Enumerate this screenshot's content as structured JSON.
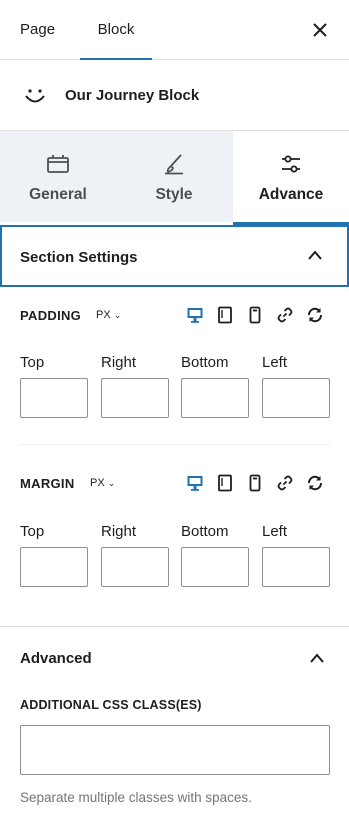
{
  "top_tabs": {
    "page": "Page",
    "block": "Block"
  },
  "block": {
    "title": "Our Journey Block"
  },
  "category_tabs": {
    "general": "General",
    "style": "Style",
    "advance": "Advance"
  },
  "section_settings": {
    "title": "Section Settings"
  },
  "padding": {
    "label": "PADDING",
    "unit": "PX",
    "sides": {
      "top": "Top",
      "right": "Right",
      "bottom": "Bottom",
      "left": "Left"
    },
    "values": {
      "top": "",
      "right": "",
      "bottom": "",
      "left": ""
    }
  },
  "margin": {
    "label": "MARGIN",
    "unit": "PX",
    "sides": {
      "top": "Top",
      "right": "Right",
      "bottom": "Bottom",
      "left": "Left"
    },
    "values": {
      "top": "",
      "right": "",
      "bottom": "",
      "left": ""
    }
  },
  "advanced": {
    "title": "Advanced",
    "css_label": "ADDITIONAL CSS CLASS(ES)",
    "css_value": "",
    "help": "Separate multiple classes with spaces."
  },
  "colors": {
    "accent": "#2271b1",
    "tab_bg": "#eef2f6",
    "help_text": "#757575"
  },
  "icons": {
    "close": "close-icon",
    "block": "smiley-icon",
    "general": "layout-icon",
    "style": "brush-icon",
    "advance": "sliders-icon",
    "chevron": "chevron-up-icon",
    "desktop": "desktop-icon",
    "tablet": "tablet-icon",
    "mobile": "mobile-icon",
    "link": "link-icon",
    "reset": "reset-icon"
  }
}
